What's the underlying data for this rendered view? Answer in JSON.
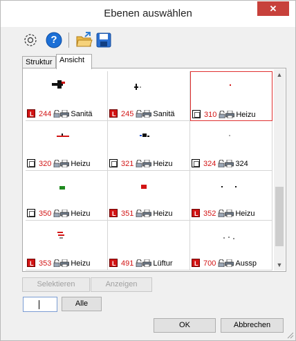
{
  "window": {
    "title": "Ebenen auswählen",
    "close_glyph": "✕"
  },
  "toolbar": {
    "icons": [
      "settings-icon",
      "help-icon",
      "open-folder-icon",
      "save-icon"
    ],
    "help_glyph": "?"
  },
  "tabs": [
    {
      "label": "Struktur"
    },
    {
      "label": "Ansicht",
      "active": true
    }
  ],
  "cells": [
    {
      "num": "244",
      "name": "Sanitä",
      "lfilled": true,
      "selected": false
    },
    {
      "num": "245",
      "name": "Sanitä",
      "lfilled": true,
      "selected": false
    },
    {
      "num": "310",
      "name": "Heizu",
      "lfilled": false,
      "selected": true
    },
    {
      "num": "320",
      "name": "Heizu",
      "lfilled": false,
      "selected": false
    },
    {
      "num": "321",
      "name": "Heizu",
      "lfilled": false,
      "selected": false
    },
    {
      "num": "324",
      "name": "324",
      "lfilled": false,
      "selected": false
    },
    {
      "num": "350",
      "name": "Heizu",
      "lfilled": false,
      "selected": false
    },
    {
      "num": "351",
      "name": "Heizu",
      "lfilled": true,
      "selected": false
    },
    {
      "num": "352",
      "name": "Heizu",
      "lfilled": true,
      "selected": false
    },
    {
      "num": "353",
      "name": "Heizu",
      "lfilled": true,
      "selected": false
    },
    {
      "num": "491",
      "name": "Lüftur",
      "lfilled": true,
      "selected": false
    },
    {
      "num": "700",
      "name": "Aussp",
      "lfilled": true,
      "selected": false
    }
  ],
  "scrollbar": {
    "up": "▲",
    "down": "▼"
  },
  "buttons": {
    "select": "Selektieren",
    "show": "Anzeigen",
    "all": "Alle",
    "ok": "OK",
    "cancel": "Abbrechen"
  },
  "filter": {
    "value": ""
  },
  "colors": {
    "number": "#d21414",
    "selection": "#e03030",
    "close": "#c7413b"
  }
}
